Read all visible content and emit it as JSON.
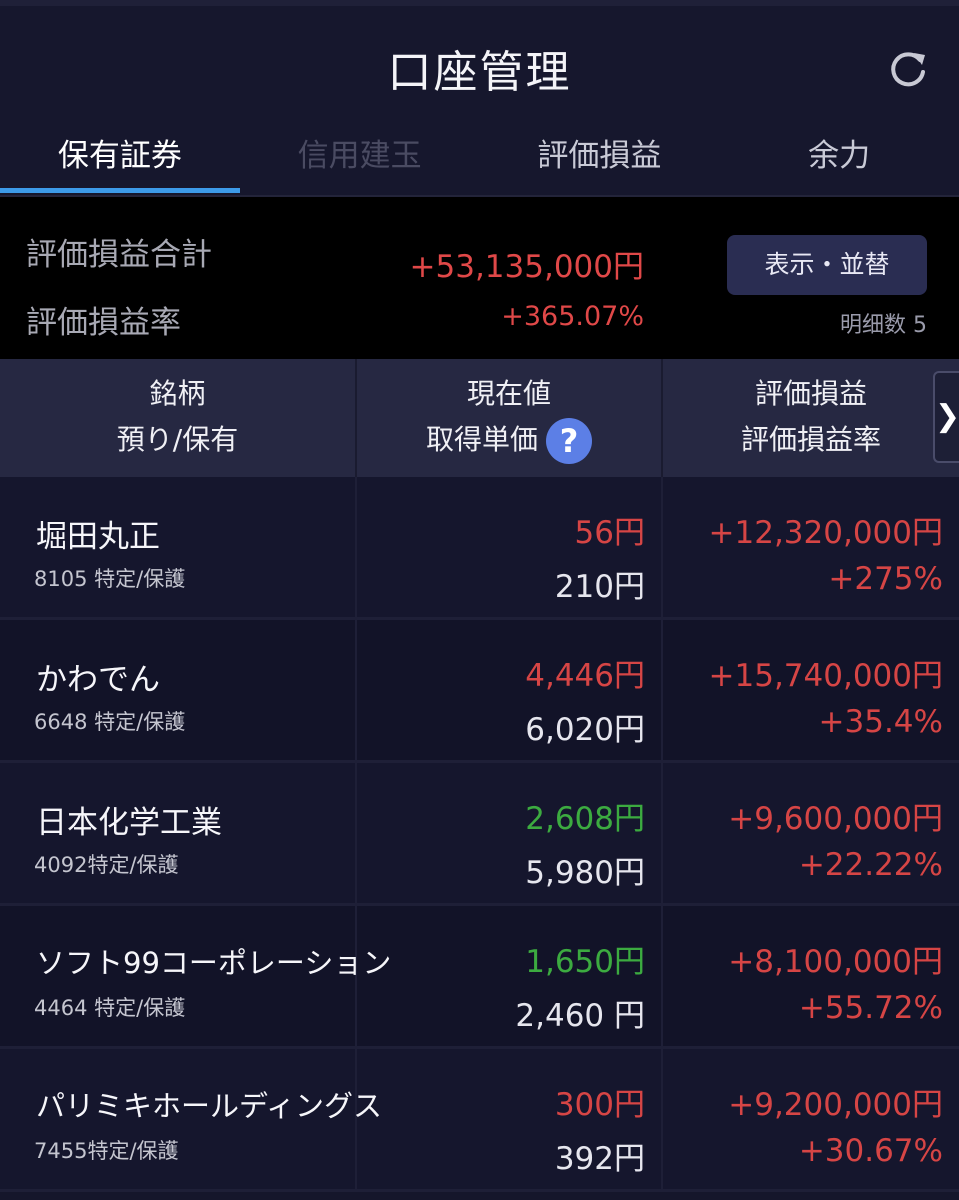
{
  "header": {
    "title": "口座管理",
    "refresh_icon": "refresh-icon"
  },
  "tabs": [
    {
      "label": "保有証券",
      "state": "active"
    },
    {
      "label": "信用建玉",
      "state": "disabled"
    },
    {
      "label": "評価損益",
      "state": "normal"
    },
    {
      "label": "余力",
      "state": "normal"
    }
  ],
  "summary": {
    "total_label": "評価損益合計",
    "total_value": "+53,135,000円",
    "rate_label": "評価損益率",
    "rate_value": "+365.07%",
    "sort_button": "表示・並替",
    "count_text": "明细数 5"
  },
  "columns": {
    "col1_line1": "銘柄",
    "col1_line2": "預り/保有",
    "col2_line1": "現在値",
    "col2_line2": "取得単価",
    "col3_line1": "評価損益",
    "col3_line2": "評価損益率",
    "help_glyph": "?",
    "next_glyph": "❯"
  },
  "colors": {
    "positive": "#d64545",
    "negative": "#3cab40",
    "accent": "#3d9be9"
  },
  "holdings": [
    {
      "name": "堀田丸正",
      "sub": "8105 特定/保護",
      "current": "56円",
      "current_color": "red",
      "cost": "210円",
      "pl": "+12,320,000円",
      "pl_rate": "+275%"
    },
    {
      "name": "かわでん",
      "sub": "6648 特定/保護",
      "current": "4,446円",
      "current_color": "red",
      "cost": "6,020円",
      "pl": "+15,740,000円",
      "pl_rate": "+35.4%"
    },
    {
      "name": "日本化学工業",
      "sub": "4092特定/保護",
      "current": "2,608円",
      "current_color": "green",
      "cost": "5,980円",
      "pl": "+9,600,000円",
      "pl_rate": "+22.22%"
    },
    {
      "name": "ソフト99コーポレーション",
      "sub": "4464 特定/保護",
      "current": "1,650円",
      "current_color": "green",
      "cost": "2,460 円",
      "pl": "+8,100,000円",
      "pl_rate": "+55.72%"
    },
    {
      "name": "パリミキホールディングス",
      "sub": "7455特定/保護",
      "current": "300円",
      "current_color": "red",
      "cost": "392円",
      "pl": "+9,200,000円",
      "pl_rate": "+30.67%"
    }
  ]
}
